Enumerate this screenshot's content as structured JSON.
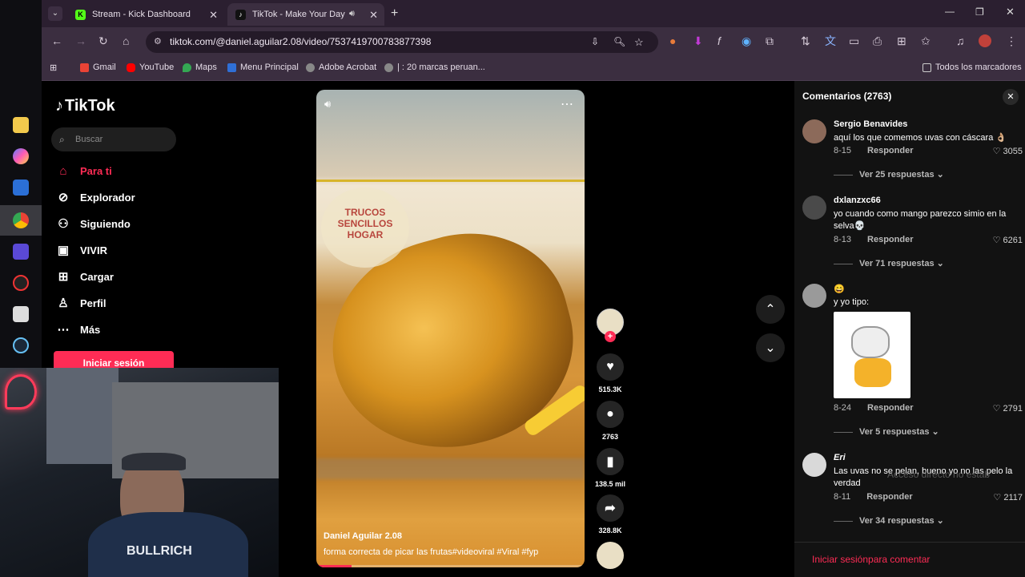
{
  "browser": {
    "tabs": [
      {
        "title": "Stream - Kick Dashboard",
        "active": false
      },
      {
        "title": "TikTok - Make Your Day",
        "active": true
      }
    ],
    "url": "tiktok.com/@daniel.aguilar2.08/video/7537419700783877398",
    "bookmarks": [
      "Gmail",
      "YouTube",
      "Maps",
      "Menu Principal",
      "Adobe Acrobat",
      "| : 20 marcas peruan..."
    ],
    "all_bookmarks": "Todos los marcadores"
  },
  "tiktok": {
    "logo": "TikTok",
    "search_placeholder": "Buscar",
    "nav": [
      "Para ti",
      "Explorador",
      "Siguiendo",
      "VIVIR",
      "Cargar",
      "Perfil",
      "Más"
    ],
    "login_button": "Iniciar sesión"
  },
  "video": {
    "author": "Daniel Aguilar 2.08",
    "caption": "forma correcta de picar las frutas#videoviral  #Viral  #fyp",
    "watermark": "TRUCOS SENCILLOS HOGAR",
    "progress": 0.13,
    "likes": "515.3K",
    "comments": "2763",
    "saves": "138.5 mil",
    "shares": "328.8K"
  },
  "comments_panel": {
    "title": "Comentarios (2763)",
    "items": [
      {
        "user": "Sergio Benavides",
        "text": "aquí los que comemos uvas con cáscara 👌🏼",
        "date": "8-15",
        "reply": "Responder",
        "likes": "3055",
        "replies": "Ver 25 respuestas"
      },
      {
        "user": "dxlanzxc66",
        "text": "yo cuando como mango parezco simio en la selva💀",
        "date": "8-13",
        "reply": "Responder",
        "likes": "6261",
        "replies": "Ver 71 respuestas"
      },
      {
        "user": "😄",
        "text": "y yo tipo:",
        "date": "8-24",
        "reply": "Responder",
        "likes": "2791",
        "replies": "Ver 5 respuestas"
      },
      {
        "user": "Eri",
        "text": "Las uvas no se pelan, bueno yo no las pelo la verdad",
        "date": "8-11",
        "reply": "Responder",
        "likes": "2117",
        "replies": "Ver 34 respuestas"
      }
    ],
    "footer": "Iniciar sesiónpara comentar"
  },
  "overlay": {
    "shortcut_ghost": "Acceso directo no estab"
  },
  "webcam": {
    "hoodie_text": "BULLRICH"
  }
}
